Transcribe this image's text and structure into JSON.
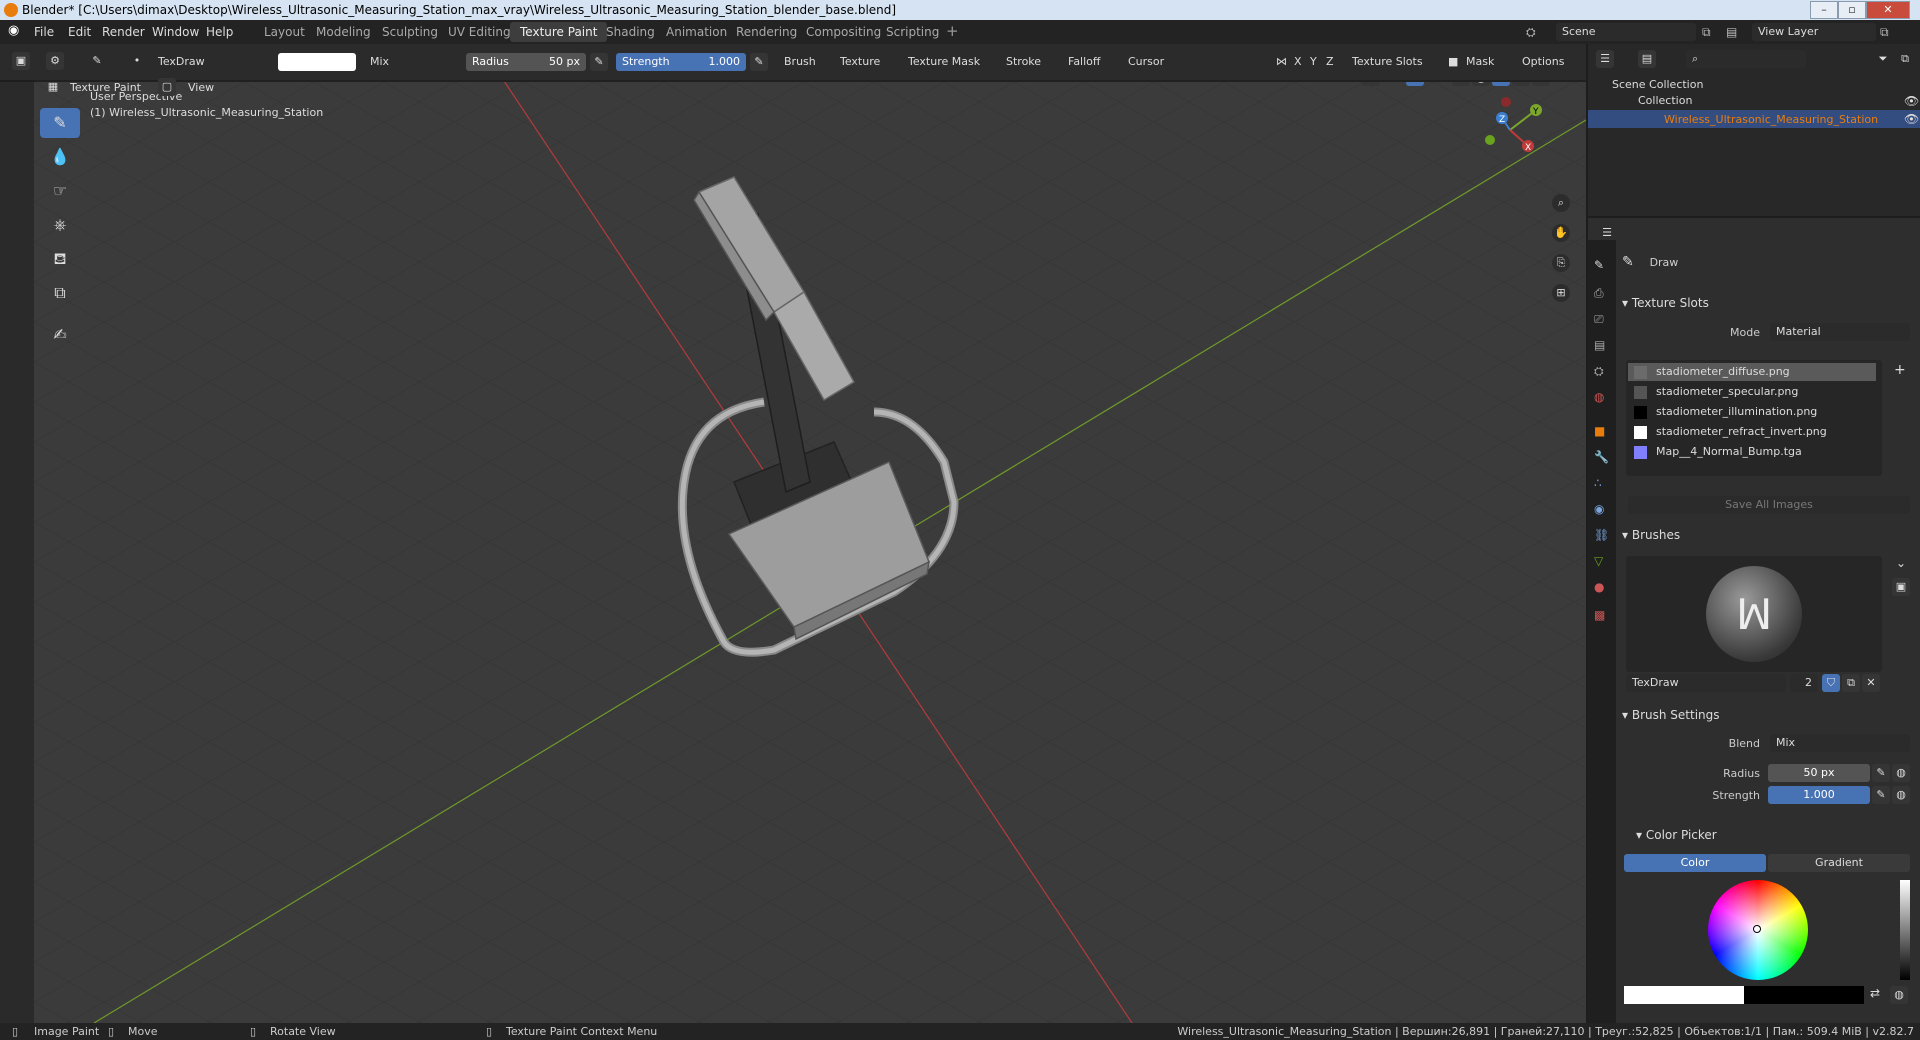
{
  "window": {
    "title": "Blender* [C:\\Users\\dimax\\Desktop\\Wireless_Ultrasonic_Measuring_Station_max_vray\\Wireless_Ultrasonic_Measuring_Station_blender_base.blend]"
  },
  "menu": {
    "file": "File",
    "edit": "Edit",
    "render": "Render",
    "window": "Window",
    "help": "Help"
  },
  "workspaces": [
    "Layout",
    "Modeling",
    "Sculpting",
    "UV Editing",
    "Texture Paint",
    "Shading",
    "Animation",
    "Rendering",
    "Compositing",
    "Scripting"
  ],
  "scene": {
    "scene_label": "Scene",
    "view_layer_label": "View Layer"
  },
  "header": {
    "brush_name": "TexDraw",
    "blend": "Mix",
    "radius_label": "Radius",
    "radius_value": "50 px",
    "strength_label": "Strength",
    "strength_value": "1.000",
    "brush": "Brush",
    "texture": "Texture",
    "texture_mask": "Texture Mask",
    "stroke": "Stroke",
    "falloff": "Falloff",
    "cursor": "Cursor",
    "axes": [
      "X",
      "Y",
      "Z"
    ],
    "texture_slots": "Texture Slots",
    "mask": "Mask",
    "options": "Options",
    "mode": "Texture Paint",
    "view": "View"
  },
  "viewport": {
    "perspective": "User Perspective",
    "object": "(1) Wireless_Ultrasonic_Measuring_Station"
  },
  "gizmo": {
    "x": "X",
    "y": "Y",
    "z": "Z"
  },
  "outliner": {
    "scene_collection": "Scene Collection",
    "collection": "Collection",
    "object": "Wireless_Ultrasonic_Measuring_Station"
  },
  "properties": {
    "tool": "Draw",
    "texture_slots_title": "Texture Slots",
    "mode_label": "Mode",
    "mode_value": "Material",
    "slots": [
      {
        "name": "stadiometer_diffuse.png",
        "color": "#6b6b6b"
      },
      {
        "name": "stadiometer_specular.png",
        "color": "#555555"
      },
      {
        "name": "stadiometer_illumination.png",
        "color": "#000000"
      },
      {
        "name": "stadiometer_refract_invert.png",
        "color": "#ffffff"
      },
      {
        "name": "Map__4_Normal_Bump.tga",
        "color": "#8080ff"
      }
    ],
    "save_all": "Save All Images",
    "brushes_title": "Brushes",
    "brush_name": "TexDraw",
    "brush_users": "2",
    "brush_settings_title": "Brush Settings",
    "blend_label": "Blend",
    "blend_value": "Mix",
    "radius_label": "Radius",
    "radius_value": "50 px",
    "strength_label": "Strength",
    "strength_value": "1.000",
    "color_picker_title": "Color Picker",
    "color_tab": "Color",
    "gradient_tab": "Gradient"
  },
  "status": {
    "image_paint": "Image Paint",
    "move": "Move",
    "rotate": "Rotate View",
    "context": "Texture Paint Context Menu",
    "stats": "Wireless_Ultrasonic_Measuring_Station | Вершин:26,891 | Граней:27,110 | Треуг.:52,825 | Объектов:1/1 | Пам.: 509.4 MiB | v2.82.7"
  },
  "colors": {
    "accent": "#4772b3",
    "selection_text": "#e87d0d",
    "x_axis": "#c23b3b",
    "y_axis": "#7ca72c",
    "z_axis": "#3a7fd0"
  }
}
